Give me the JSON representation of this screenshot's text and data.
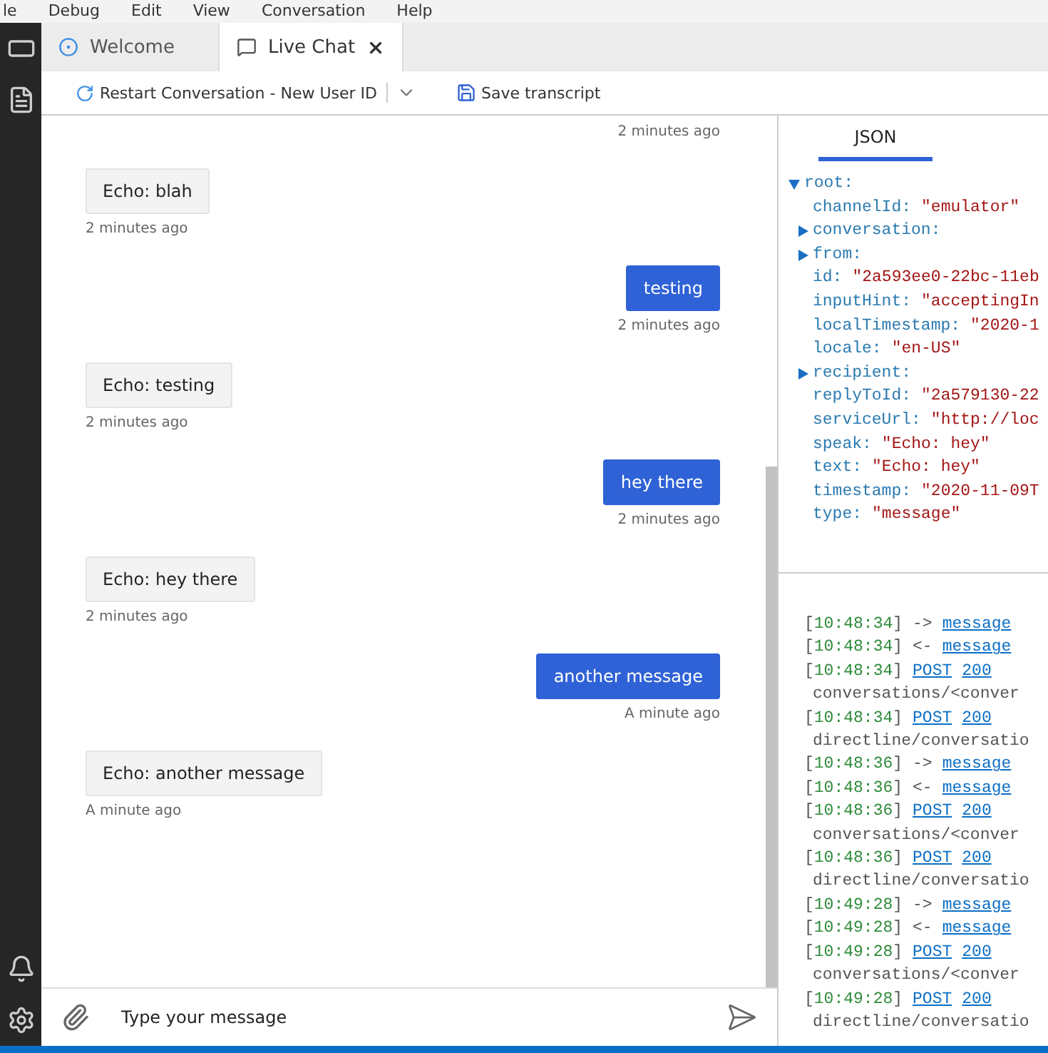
{
  "menu_bar": [
    "le",
    "Debug",
    "Edit",
    "View",
    "Conversation",
    "Help"
  ],
  "tabs": [
    {
      "label": "Welcome",
      "kind": "welcome",
      "selected": false
    },
    {
      "label": "Live Chat",
      "kind": "chat",
      "selected": true
    }
  ],
  "toolbar": {
    "restart": "Restart Conversation - New User ID",
    "save": "Save transcript"
  },
  "chat": {
    "messages": [
      {
        "kind": "user",
        "time": "2 minutes ago"
      },
      {
        "kind": "bot",
        "text": "Echo: blah",
        "time": "2 minutes ago"
      },
      {
        "kind": "user",
        "text": "testing",
        "time": "2 minutes ago"
      },
      {
        "kind": "bot",
        "text": "Echo: testing",
        "time": "2 minutes ago"
      },
      {
        "kind": "user",
        "text": "hey there",
        "time": "2 minutes ago"
      },
      {
        "kind": "bot",
        "text": "Echo: hey there",
        "time": "2 minutes ago"
      },
      {
        "kind": "user",
        "text": "another message",
        "time": "A minute ago"
      },
      {
        "kind": "bot",
        "text": "Echo: another message",
        "time": "A minute ago"
      }
    ],
    "input": {
      "placeholder": "Type your message"
    }
  },
  "inspector": {
    "tabs": [
      {
        "label": "JSON",
        "selected": true
      }
    ],
    "tree": {
      "key": "root:",
      "expanded": true,
      "children": [
        {
          "key": "channelId:",
          "value": "\"emulator\""
        },
        {
          "key": "conversation:",
          "expanded": false
        },
        {
          "key": "from:",
          "expanded": false
        },
        {
          "key": "id:",
          "value": "\"2a593ee0-22bc-11eb"
        },
        {
          "key": "inputHint:",
          "value": "\"acceptingIn"
        },
        {
          "key": "localTimestamp:",
          "value": "\"2020-1"
        },
        {
          "key": "locale:",
          "value": "\"en-US\""
        },
        {
          "key": "recipient:",
          "expanded": false
        },
        {
          "key": "replyToId:",
          "value": "\"2a579130-22"
        },
        {
          "key": "serviceUrl:",
          "value": "\"http://loc"
        },
        {
          "key": "speak:",
          "value": "\"Echo: hey\""
        },
        {
          "key": "text:",
          "value": "\"Echo: hey\""
        },
        {
          "key": "timestamp:",
          "value": "\"2020-11-09T"
        },
        {
          "key": "type:",
          "value": "\"message\""
        }
      ]
    }
  },
  "log": [
    {
      "kind": "activity",
      "time": "[10:48:34]",
      "arrow": "->",
      "link": "message"
    },
    {
      "kind": "activity",
      "time": "[10:48:34]",
      "arrow": "<-",
      "link": "message"
    },
    {
      "kind": "request",
      "time": "[10:48:34]",
      "method": "POST",
      "status": "200",
      "path": "conversations/<conver"
    },
    {
      "kind": "request",
      "time": "[10:48:34]",
      "method": "POST",
      "status": "200",
      "path": "directline/conversatio"
    },
    {
      "kind": "activity",
      "time": "[10:48:36]",
      "arrow": "->",
      "link": "message"
    },
    {
      "kind": "activity",
      "time": "[10:48:36]",
      "arrow": "<-",
      "link": "message"
    },
    {
      "kind": "request",
      "time": "[10:48:36]",
      "method": "POST",
      "status": "200",
      "path": "conversations/<conver"
    },
    {
      "kind": "request",
      "time": "[10:48:36]",
      "method": "POST",
      "status": "200",
      "path": "directline/conversatio"
    },
    {
      "kind": "activity",
      "time": "[10:49:28]",
      "arrow": "->",
      "link": "message"
    },
    {
      "kind": "activity",
      "time": "[10:49:28]",
      "arrow": "<-",
      "link": "message"
    },
    {
      "kind": "request",
      "time": "[10:49:28]",
      "method": "POST",
      "status": "200",
      "path": "conversations/<conver"
    },
    {
      "kind": "request",
      "time": "[10:49:28]",
      "method": "POST",
      "status": "200",
      "path": "directline/conversatio"
    }
  ]
}
